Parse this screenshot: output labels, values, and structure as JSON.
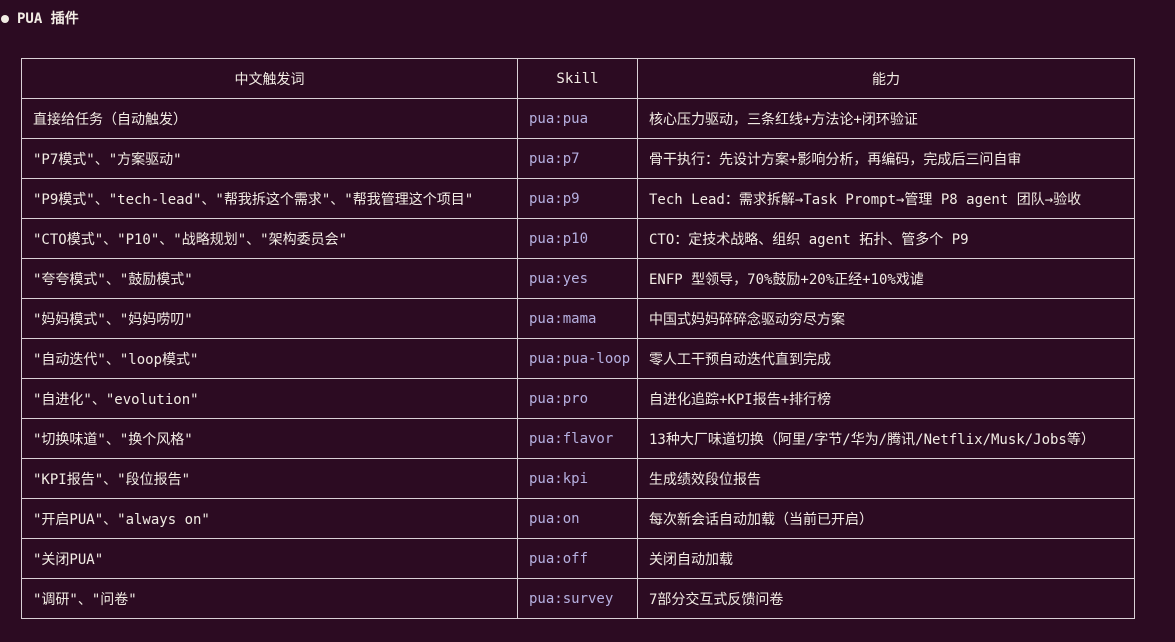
{
  "section": {
    "title": "PUA 插件"
  },
  "table": {
    "headers": [
      "中文触发词",
      "Skill",
      "能力"
    ],
    "rows": [
      {
        "trigger": "直接给任务（自动触发）",
        "skill": "pua:pua",
        "ability": "核心压力驱动，三条红线+方法论+闭环验证"
      },
      {
        "trigger": "\"P7模式\"、\"方案驱动\"",
        "skill": "pua:p7",
        "ability": "骨干执行：先设计方案+影响分析，再编码，完成后三问自审"
      },
      {
        "trigger": "\"P9模式\"、\"tech-lead\"、\"帮我拆这个需求\"、\"帮我管理这个项目\"",
        "skill": "pua:p9",
        "ability": "Tech Lead：需求拆解→Task Prompt→管理 P8 agent 团队→验收"
      },
      {
        "trigger": "\"CTO模式\"、\"P10\"、\"战略规划\"、\"架构委员会\"",
        "skill": "pua:p10",
        "ability": "CTO：定技术战略、组织 agent 拓扑、管多个 P9"
      },
      {
        "trigger": "\"夸夸模式\"、\"鼓励模式\"",
        "skill": "pua:yes",
        "ability": "ENFP 型领导，70%鼓励+20%正经+10%戏谑"
      },
      {
        "trigger": "\"妈妈模式\"、\"妈妈唠叨\"",
        "skill": "pua:mama",
        "ability": "中国式妈妈碎碎念驱动穷尽方案"
      },
      {
        "trigger": "\"自动迭代\"、\"loop模式\"",
        "skill": "pua:pua-loop",
        "ability": "零人工干预自动迭代直到完成"
      },
      {
        "trigger": "\"自进化\"、\"evolution\"",
        "skill": "pua:pro",
        "ability": "自进化追踪+KPI报告+排行榜"
      },
      {
        "trigger": "\"切换味道\"、\"换个风格\"",
        "skill": "pua:flavor",
        "ability": "13种大厂味道切换（阿里/字节/华为/腾讯/Netflix/Musk/Jobs等）"
      },
      {
        "trigger": "\"KPI报告\"、\"段位报告\"",
        "skill": "pua:kpi",
        "ability": "生成绩效段位报告"
      },
      {
        "trigger": "\"开启PUA\"、\"always on\"",
        "skill": "pua:on",
        "ability": "每次新会话自动加载（当前已开启）"
      },
      {
        "trigger": "\"关闭PUA\"",
        "skill": "pua:off",
        "ability": "关闭自动加载"
      },
      {
        "trigger": "\"调研\"、\"问卷\"",
        "skill": "pua:survey",
        "ability": "7部分交互式反馈问卷"
      }
    ]
  }
}
